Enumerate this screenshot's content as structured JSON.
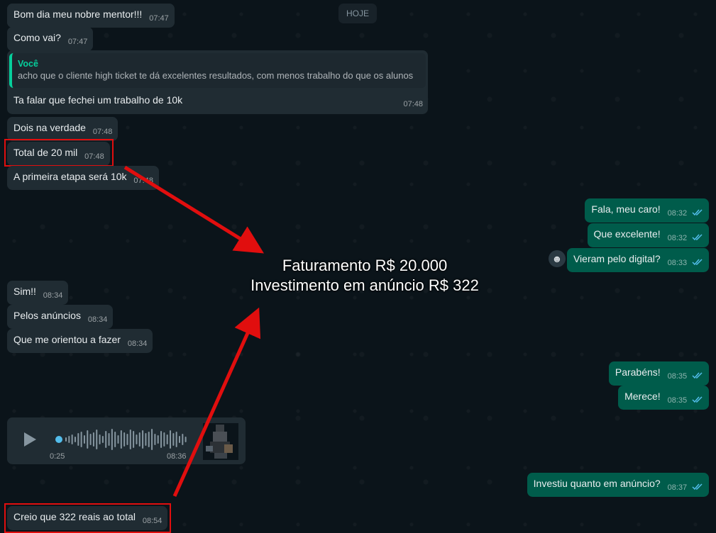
{
  "date_chip": "HOJE",
  "incoming": [
    {
      "text": "Bom dia meu nobre mentor!!!",
      "time": "07:47"
    },
    {
      "text": "Como vai?",
      "time": "07:47"
    },
    {
      "text": "Ta falar que fechei um trabalho de 10k",
      "time": "07:48",
      "quote_author": "Você",
      "quote_text": "acho que o cliente high ticket te dá excelentes resultados, com menos trabalho do que os alunos"
    },
    {
      "text": "Dois na verdade",
      "time": "07:48"
    },
    {
      "text": "Total de 20 mil",
      "time": "07:48"
    },
    {
      "text": "A primeira etapa será 10k",
      "time": "07:48"
    },
    {
      "text": "Sim!!",
      "time": "08:34"
    },
    {
      "text": "Pelos anúncios",
      "time": "08:34"
    },
    {
      "text": "Que me orientou a fazer",
      "time": "08:34"
    },
    {
      "text": "Creio que 322 reais ao total",
      "time": "08:54"
    }
  ],
  "outgoing": [
    {
      "text": "Fala, meu caro!",
      "time": "08:32"
    },
    {
      "text": "Que excelente!",
      "time": "08:32"
    },
    {
      "text": "Vieram pelo digital?",
      "time": "08:33"
    },
    {
      "text": "Parabéns!",
      "time": "08:35"
    },
    {
      "text": "Merece!",
      "time": "08:35"
    },
    {
      "text": "Investiu quanto em anúncio?",
      "time": "08:37"
    }
  ],
  "audio": {
    "duration": "0:25",
    "time": "08:36",
    "progress": 0.0
  },
  "reaction_emoji": "☻",
  "overlay": {
    "line1": "Faturamento R$ 20.000",
    "line2": "Investimento em anúncio R$ 322"
  },
  "colors": {
    "background": "#0b141a",
    "incoming_bubble": "#202c33",
    "outgoing_bubble": "#005c4b",
    "read_check": "#53bdeb",
    "quote_accent": "#06cf9c",
    "highlight": "#e10e0e"
  },
  "icons": [
    "play-icon",
    "double-check-icon",
    "emoji-icon"
  ]
}
